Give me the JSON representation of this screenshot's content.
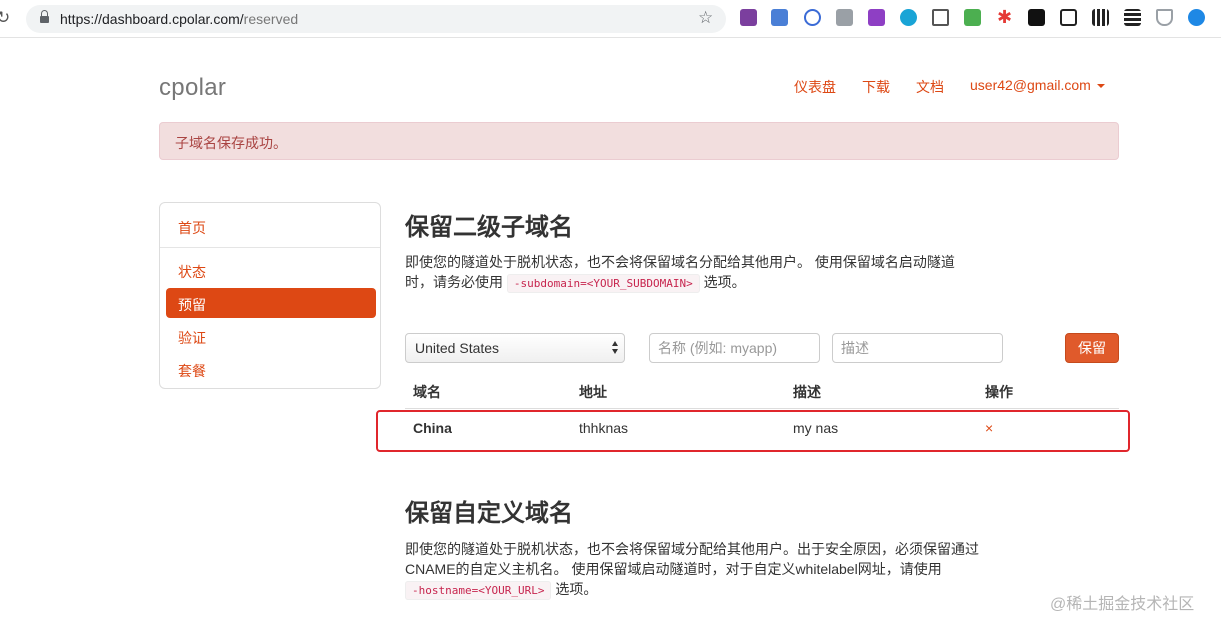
{
  "browser": {
    "url_host": "https://dashboard.cpolar.com/",
    "url_path": "reserved"
  },
  "header": {
    "brand": "cpolar",
    "nav": [
      "仪表盘",
      "下载",
      "文档"
    ],
    "user": "user42@gmail.com"
  },
  "alert": {
    "message": "子域名保存成功。"
  },
  "sidebar": {
    "items": [
      {
        "label": "首页"
      },
      {
        "label": "状态"
      },
      {
        "label": "预留"
      },
      {
        "label": "验证"
      },
      {
        "label": "套餐"
      }
    ],
    "active": "预留"
  },
  "subdomain_section": {
    "title": "保留二级子域名",
    "desc_line1": "即使您的隧道处于脱机状态，也不会将保留域名分配给其他用户。 使用保留域名启动隧道",
    "desc_line2_prefix": "时，请务必使用",
    "desc_code": "-subdomain=<YOUR_SUBDOMAIN>",
    "desc_line2_suffix": "选项。",
    "form": {
      "region_selected": "United States",
      "name_placeholder": "名称 (例如: myapp)",
      "desc_placeholder": "描述",
      "submit_label": "保留"
    },
    "table": {
      "headers": [
        "域名",
        "地址",
        "描述",
        "操作"
      ],
      "rows": [
        {
          "region": "China",
          "address": "thhknas",
          "description": "my nas",
          "action": "×"
        }
      ]
    }
  },
  "custom_domain_section": {
    "title": "保留自定义域名",
    "desc_line1": "即使您的隧道处于脱机状态，也不会将保留域分配给其他用户。出于安全原因，必须保留通过",
    "desc_line2": "CNAME的自定义主机名。 使用保留域启动隧道时，对于自定义whitelabel网址，请使用",
    "desc_code": "-hostname=<YOUR_URL>",
    "desc_line3_suffix": "选项。"
  },
  "watermark": "@稀土掘金技术社区",
  "colors": {
    "accent": "#dd4814",
    "alert_bg": "#f2dede",
    "alert_text": "#a94442",
    "highlight_border": "#e0262c"
  }
}
